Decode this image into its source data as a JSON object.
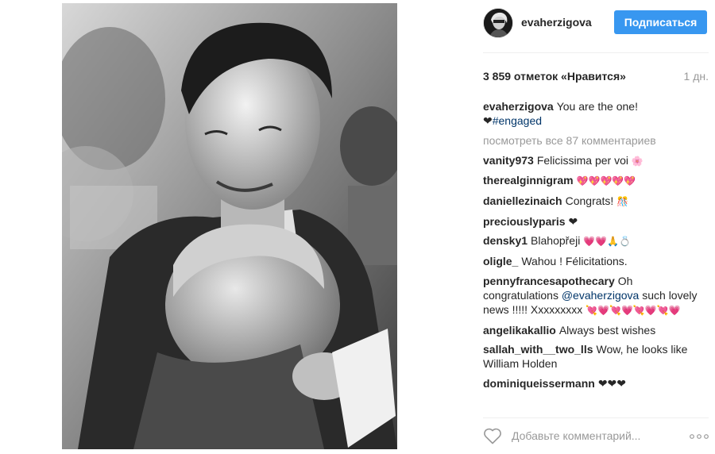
{
  "post": {
    "image_alt": "Black and white photo of a smiling man holding a child"
  },
  "header": {
    "username": "evaherzigova",
    "follow_label": "Подписаться"
  },
  "stats": {
    "likes": "3 859 отметок «Нравится»",
    "time": "1 дн."
  },
  "caption": {
    "user": "evaherzigova",
    "text_line1": "You are the one!",
    "heart": "❤",
    "hashtag": "#engaged"
  },
  "view_all": "посмотреть все 87 комментариев",
  "comments": [
    {
      "user": "vanity973",
      "text": "Felicissima per voi",
      "emoji": "🌸"
    },
    {
      "user": "therealginnigram",
      "text": "",
      "emoji": "💖💖💖💖💖"
    },
    {
      "user": "daniellezinaich",
      "text": "Congrats!",
      "emoji": "🎊"
    },
    {
      "user": "preciouslyparis",
      "text": "",
      "emoji": "❤"
    },
    {
      "user": "densky1",
      "text": "Blahopřeji",
      "emoji": "💗💗🙏💍"
    },
    {
      "user": "oligle_",
      "text": "Wahou ! Félicitations.",
      "emoji": ""
    },
    {
      "user": "pennyfrancesapothecary",
      "text_pre": "Oh congratulations",
      "mention": "@evaherzigova",
      "text_post": "such lovely news !!!!! Xxxxxxxxx",
      "emoji": "💘💗💘💗💘💗💘💗"
    },
    {
      "user": "angelikakallio",
      "text": "Always best wishes",
      "emoji": ""
    },
    {
      "user": "sallah_with__two_lls",
      "text": "Wow, he looks like William Holden",
      "emoji": ""
    },
    {
      "user": "dominiqueissermann",
      "text": "",
      "emoji": "❤❤❤"
    }
  ],
  "add_comment": {
    "placeholder": "Добавьте комментарий..."
  },
  "icons": {
    "like": "heart-outline-icon",
    "more": "ellipsis-icon"
  }
}
